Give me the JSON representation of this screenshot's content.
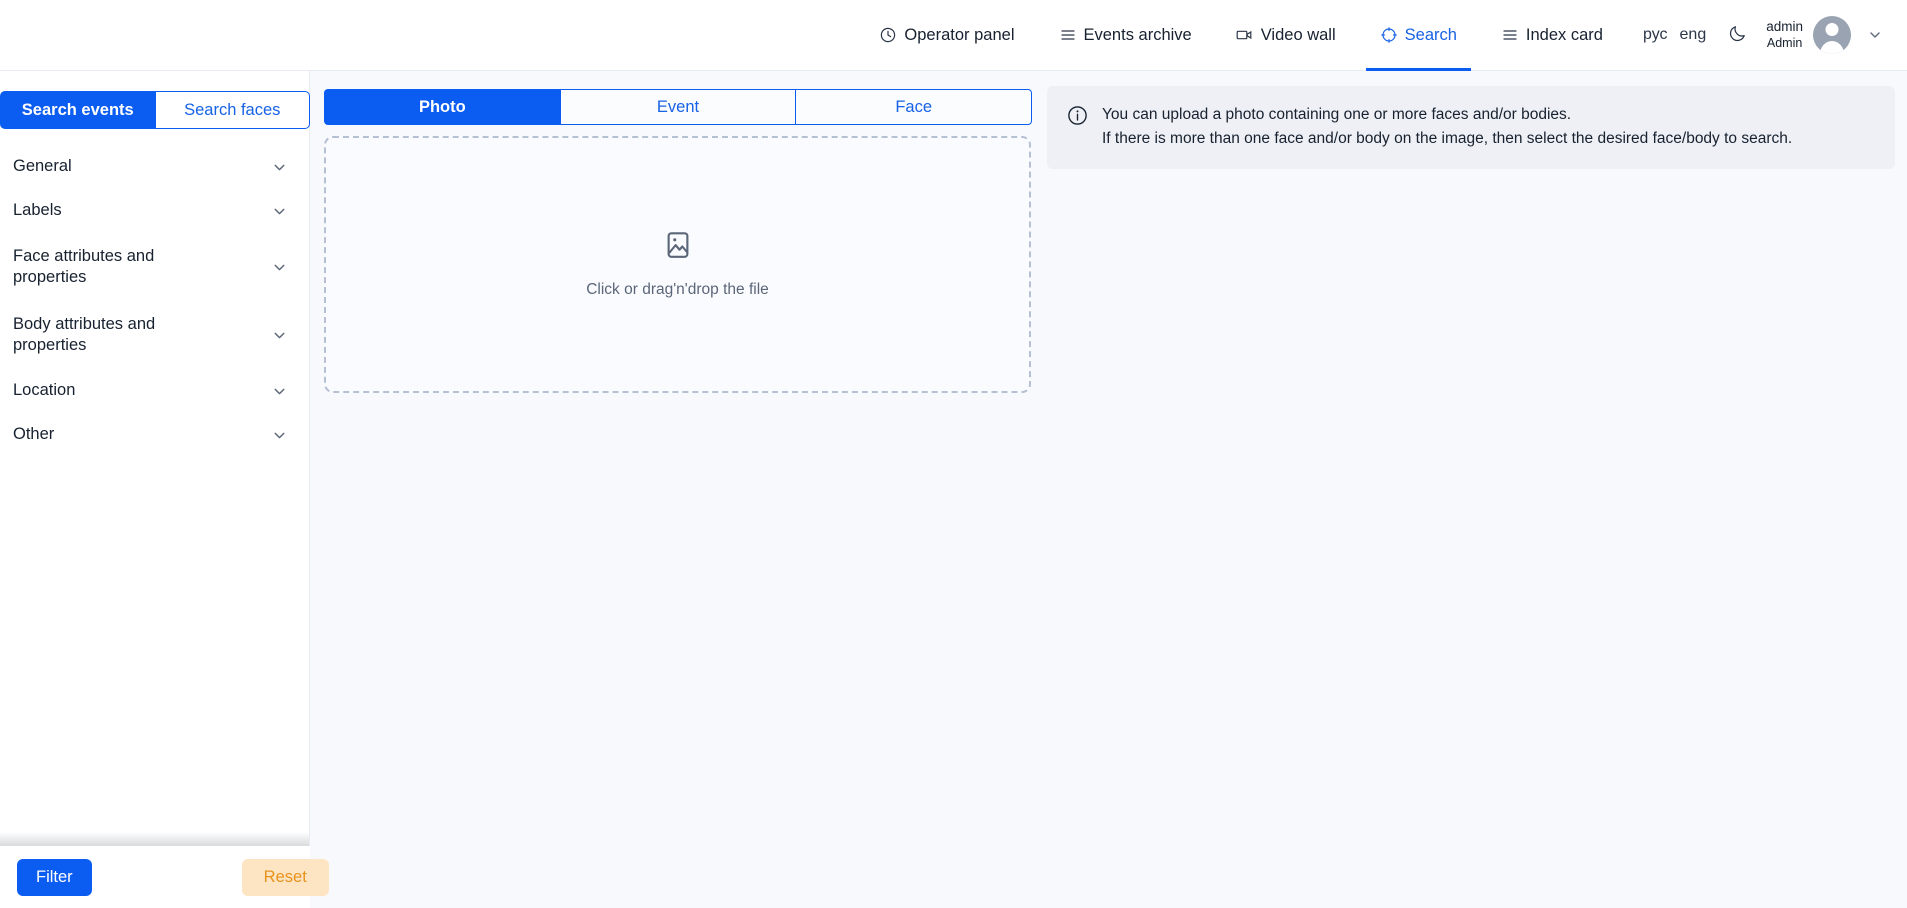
{
  "header": {
    "nav": [
      {
        "label": "Operator panel",
        "icon": "clock-icon",
        "active": false
      },
      {
        "label": "Events archive",
        "icon": "list-icon",
        "active": false
      },
      {
        "label": "Video wall",
        "icon": "video-camera-icon",
        "active": false
      },
      {
        "label": "Search",
        "icon": "target-search-icon",
        "active": true
      },
      {
        "label": "Index card",
        "icon": "list-icon",
        "active": false
      }
    ],
    "languages": {
      "ru": "рус",
      "en": "eng"
    },
    "theme_icon": "moon-icon",
    "user": {
      "login": "admin",
      "role": "Admin",
      "avatar_icon": "user-avatar-icon",
      "caret_icon": "chevron-down-icon"
    }
  },
  "sidebar": {
    "segmented": {
      "events": "Search events",
      "faces": "Search faces",
      "selected": "Search events"
    },
    "sections": [
      {
        "label": "General"
      },
      {
        "label": "Labels"
      },
      {
        "label": "Face attributes and properties"
      },
      {
        "label": "Body attributes and properties"
      },
      {
        "label": "Location"
      },
      {
        "label": "Other"
      }
    ],
    "footer": {
      "filter_label": "Filter",
      "reset_label": "Reset"
    }
  },
  "main": {
    "tabs": [
      {
        "label": "Photo",
        "active": true
      },
      {
        "label": "Event",
        "active": false
      },
      {
        "label": "Face",
        "active": false
      }
    ],
    "dropzone": {
      "text": "Click or drag'n'drop the file",
      "icon": "image-placeholder-icon"
    },
    "info": {
      "icon": "info-circle-icon",
      "line1": "You can upload a photo containing one or more faces and/or bodies.",
      "line2": "If there is more than one face and/or body on the image, then select the desired face/body to search."
    }
  },
  "colors": {
    "accent": "#0b5cf0",
    "accent_text": "#1762e5",
    "reset_bg": "#fde5c3",
    "reset_text": "#e8921c",
    "main_bg": "#f7f9fd",
    "info_bg": "#eef0f5"
  }
}
